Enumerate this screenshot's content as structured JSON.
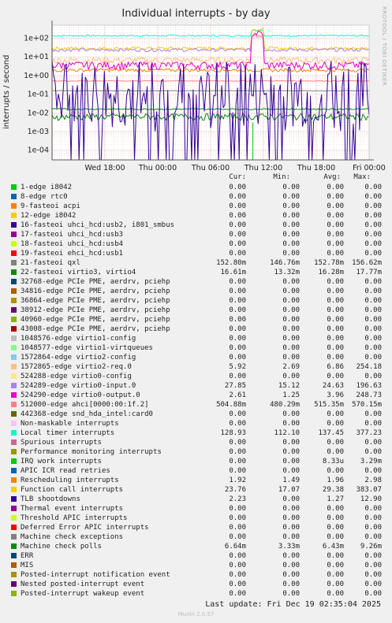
{
  "title": "Individual interrupts - by day",
  "side_label": "RRDTOOL / TOBI OETIKER",
  "footer": "Last update: Fri Dec 19 02:35:04 2025",
  "munin_version": "Munin 2.0.57",
  "legend_headers": {
    "cur": "Cur:",
    "min": "Min:",
    "avg": "Avg:",
    "max": "Max:"
  },
  "chart_data": {
    "type": "line",
    "title": "Individual interrupts - by day",
    "ylabel": "interrupts / second",
    "yscale": "log",
    "ylim": [
      3e-05,
      500
    ],
    "ytick_values": [
      0.0001,
      0.001,
      0.01,
      0.1,
      1,
      10,
      100
    ],
    "ytick_labels": [
      "1e-04",
      "1e-03",
      "1e-02",
      "1e-01",
      "1e+00",
      "1e+01",
      "1e+02"
    ],
    "xlim_hours": [
      -30,
      6
    ],
    "xtick_hours": [
      -24,
      -18,
      -12,
      -6,
      0,
      6
    ],
    "xtick_labels": [
      "Wed 18:00",
      "Thu 00:00",
      "Thu 06:00",
      "Thu 12:00",
      "Thu 18:00",
      "Fri 00:00"
    ],
    "grid": true,
    "series": [
      {
        "name": "1-edge i8042",
        "color": "#00cc00",
        "cur": "0.00",
        "min": "0.00",
        "avg": "0.00",
        "max": "0.00"
      },
      {
        "name": "8-edge rtc0",
        "color": "#0066b3",
        "cur": "0.00",
        "min": "0.00",
        "avg": "0.00",
        "max": "0.00"
      },
      {
        "name": "9-fasteoi acpi",
        "color": "#ff8000",
        "cur": "0.00",
        "min": "0.00",
        "avg": "0.00",
        "max": "0.00"
      },
      {
        "name": "12-edge i8042",
        "color": "#ffcc00",
        "cur": "0.00",
        "min": "0.00",
        "avg": "0.00",
        "max": "0.00"
      },
      {
        "name": "16-fasteoi uhci_hcd:usb2, i801_smbus",
        "color": "#330099",
        "cur": "0.00",
        "min": "0.00",
        "avg": "0.00",
        "max": "0.00"
      },
      {
        "name": "17-fasteoi uhci_hcd:usb3",
        "color": "#990099",
        "cur": "0.00",
        "min": "0.00",
        "avg": "0.00",
        "max": "0.00"
      },
      {
        "name": "18-fasteoi uhci_hcd:usb4",
        "color": "#ccff00",
        "cur": "0.00",
        "min": "0.00",
        "avg": "0.00",
        "max": "0.00"
      },
      {
        "name": "19-fasteoi ehci_hcd:usb1",
        "color": "#ff0000",
        "cur": "0.00",
        "min": "0.00",
        "avg": "0.00",
        "max": "0.00"
      },
      {
        "name": "21-fasteoi qxl",
        "color": "#808080",
        "cur": "152.80m",
        "min": "146.76m",
        "avg": "152.78m",
        "max": "156.62m"
      },
      {
        "name": "22-fasteoi virtio3, virtio4",
        "color": "#008f00",
        "cur": "16.61m",
        "min": "13.32m",
        "avg": "16.28m",
        "max": "17.77m"
      },
      {
        "name": "32768-edge PCIe PME, aerdrv, pciehp",
        "color": "#00487d",
        "cur": "0.00",
        "min": "0.00",
        "avg": "0.00",
        "max": "0.00"
      },
      {
        "name": "34816-edge PCIe PME, aerdrv, pciehp",
        "color": "#b35a00",
        "cur": "0.00",
        "min": "0.00",
        "avg": "0.00",
        "max": "0.00"
      },
      {
        "name": "36864-edge PCIe PME, aerdrv, pciehp",
        "color": "#b38f00",
        "cur": "0.00",
        "min": "0.00",
        "avg": "0.00",
        "max": "0.00"
      },
      {
        "name": "38912-edge PCIe PME, aerdrv, pciehp",
        "color": "#6b006b",
        "cur": "0.00",
        "min": "0.00",
        "avg": "0.00",
        "max": "0.00"
      },
      {
        "name": "40960-edge PCIe PME, aerdrv, pciehp",
        "color": "#8fb300",
        "cur": "0.00",
        "min": "0.00",
        "avg": "0.00",
        "max": "0.00"
      },
      {
        "name": "43008-edge PCIe PME, aerdrv, pciehp",
        "color": "#b30000",
        "cur": "0.00",
        "min": "0.00",
        "avg": "0.00",
        "max": "0.00"
      },
      {
        "name": "1048576-edge virtio1-config",
        "color": "#bebebe",
        "cur": "0.00",
        "min": "0.00",
        "avg": "0.00",
        "max": "0.00"
      },
      {
        "name": "1048577-edge virtio1-virtqueues",
        "color": "#80ff80",
        "cur": "0.00",
        "min": "0.00",
        "avg": "0.00",
        "max": "0.00"
      },
      {
        "name": "1572864-edge virtio2-config",
        "color": "#80c9ff",
        "cur": "0.00",
        "min": "0.00",
        "avg": "0.00",
        "max": "0.00"
      },
      {
        "name": "1572865-edge virtio2-req.0",
        "color": "#ffc080",
        "cur": "5.92",
        "min": "2.69",
        "avg": "6.86",
        "max": "254.18"
      },
      {
        "name": "524288-edge virtio0-config",
        "color": "#ffe680",
        "cur": "0.00",
        "min": "0.00",
        "avg": "0.00",
        "max": "0.00"
      },
      {
        "name": "524289-edge virtio0-input.0",
        "color": "#aa80ff",
        "cur": "27.85",
        "min": "15.12",
        "avg": "24.63",
        "max": "196.63"
      },
      {
        "name": "524290-edge virtio0-output.0",
        "color": "#ee00cc",
        "cur": "2.61",
        "min": "1.25",
        "avg": "3.96",
        "max": "248.73"
      },
      {
        "name": "512000-edge ahci[0000:00:1f.2]",
        "color": "#ff8080",
        "cur": "504.88m",
        "min": "480.29m",
        "avg": "515.35m",
        "max": "570.15m"
      },
      {
        "name": "442368-edge snd_hda_intel:card0",
        "color": "#666600",
        "cur": "0.00",
        "min": "0.00",
        "avg": "0.00",
        "max": "0.00"
      },
      {
        "name": "Non-maskable interrupts",
        "color": "#ffbfff",
        "cur": "0.00",
        "min": "0.00",
        "avg": "0.00",
        "max": "0.00"
      },
      {
        "name": "Local timer interrupts",
        "color": "#00ffcc",
        "cur": "128.93",
        "min": "112.10",
        "avg": "137.45",
        "max": "377.23"
      },
      {
        "name": "Spurious interrupts",
        "color": "#cc6699",
        "cur": "0.00",
        "min": "0.00",
        "avg": "0.00",
        "max": "0.00"
      },
      {
        "name": "Performance monitoring interrupts",
        "color": "#999900",
        "cur": "0.00",
        "min": "0.00",
        "avg": "0.00",
        "max": "0.00"
      },
      {
        "name": "IRQ work interrupts",
        "color": "#00cc00",
        "cur": "0.00",
        "min": "0.00",
        "avg": "8.33u",
        "max": "3.29m"
      },
      {
        "name": "APIC ICR read retries",
        "color": "#0066b3",
        "cur": "0.00",
        "min": "0.00",
        "avg": "0.00",
        "max": "0.00"
      },
      {
        "name": "Rescheduling interrupts",
        "color": "#ff8000",
        "cur": "1.92",
        "min": "1.49",
        "avg": "1.96",
        "max": "2.98"
      },
      {
        "name": "Function call interrupts",
        "color": "#ffcc00",
        "cur": "23.76",
        "min": "17.07",
        "avg": "29.38",
        "max": "383.07"
      },
      {
        "name": "TLB shootdowns",
        "color": "#330099",
        "cur": "2.23",
        "min": "0.00",
        "avg": "1.27",
        "max": "12.90"
      },
      {
        "name": "Thermal event interrupts",
        "color": "#990099",
        "cur": "0.00",
        "min": "0.00",
        "avg": "0.00",
        "max": "0.00"
      },
      {
        "name": "Threshold APIC interrupts",
        "color": "#ccff00",
        "cur": "0.00",
        "min": "0.00",
        "avg": "0.00",
        "max": "0.00"
      },
      {
        "name": "Deferred Error APIC interrupts",
        "color": "#ff0000",
        "cur": "0.00",
        "min": "0.00",
        "avg": "0.00",
        "max": "0.00"
      },
      {
        "name": "Machine check exceptions",
        "color": "#808080",
        "cur": "0.00",
        "min": "0.00",
        "avg": "0.00",
        "max": "0.00"
      },
      {
        "name": "Machine check polls",
        "color": "#008f00",
        "cur": "6.64m",
        "min": "3.33m",
        "avg": "6.43m",
        "max": "9.26m"
      },
      {
        "name": "ERR",
        "color": "#00487d",
        "cur": "0.00",
        "min": "0.00",
        "avg": "0.00",
        "max": "0.00"
      },
      {
        "name": "MIS",
        "color": "#b35a00",
        "cur": "0.00",
        "min": "0.00",
        "avg": "0.00",
        "max": "0.00"
      },
      {
        "name": "Posted-interrupt notification event",
        "color": "#b38f00",
        "cur": "0.00",
        "min": "0.00",
        "avg": "0.00",
        "max": "0.00"
      },
      {
        "name": "Nested posted-interrupt event",
        "color": "#6b006b",
        "cur": "0.00",
        "min": "0.00",
        "avg": "0.00",
        "max": "0.00"
      },
      {
        "name": "Posted-interrupt wakeup event",
        "color": "#8fb300",
        "cur": "0.00",
        "min": "0.00",
        "avg": "0.00",
        "max": "0.00"
      }
    ]
  }
}
